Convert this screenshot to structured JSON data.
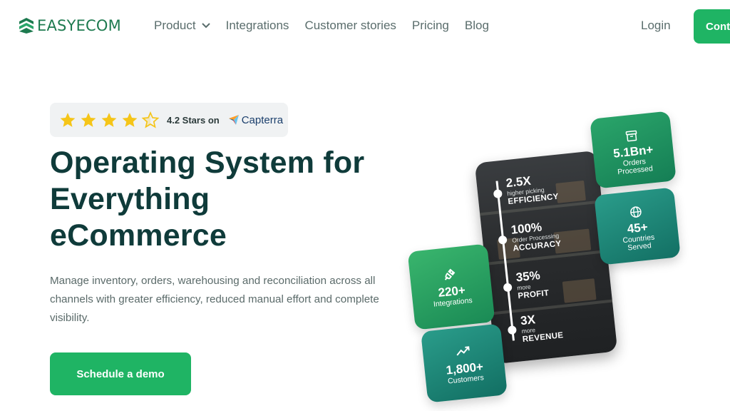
{
  "brand": {
    "name": "EASYECOM",
    "color": "#1d7a4f"
  },
  "nav": {
    "items": [
      {
        "label": "Product",
        "has_dropdown": true
      },
      {
        "label": "Integrations"
      },
      {
        "label": "Customer stories"
      },
      {
        "label": "Pricing"
      },
      {
        "label": "Blog"
      }
    ],
    "login": "Login",
    "cta": "Contact"
  },
  "rating": {
    "stars": 4.2,
    "text": "4.2 Stars on",
    "platform": "Capterra",
    "star_color": "#f5c518"
  },
  "hero": {
    "title_line1": "Operating System for",
    "title_line2": "Everything",
    "title_line3": "eCommerce",
    "description": "Manage inventory, orders, warehousing and reconciliation across all channels with greater efficiency, reduced manual effort and complete visibility.",
    "cta": "Schedule a demo",
    "accent": "#1fb464"
  },
  "phone_stats": [
    {
      "value": "2.5X",
      "sub": "higher picking",
      "label": "EFFICIENCY"
    },
    {
      "value": "100%",
      "sub": "Order Processing",
      "label": "ACCURACY"
    },
    {
      "value": "35%",
      "sub": "more",
      "label": "PROFIT"
    },
    {
      "value": "3X",
      "sub": "more",
      "label": "REVENUE"
    }
  ],
  "cards": {
    "orders": {
      "value": "5.1Bn+",
      "label_line1": "Orders",
      "label_line2": "Processed",
      "icon": "archive-box-icon"
    },
    "countries": {
      "value": "45+",
      "label_line1": "Countries",
      "label_line2": "Served",
      "icon": "globe-icon"
    },
    "integrations": {
      "value": "220+",
      "label_line1": "Integrations",
      "icon": "plug-icon"
    },
    "customers": {
      "value": "1,800+",
      "label_line1": "Customers",
      "icon": "trending-up-icon"
    }
  }
}
